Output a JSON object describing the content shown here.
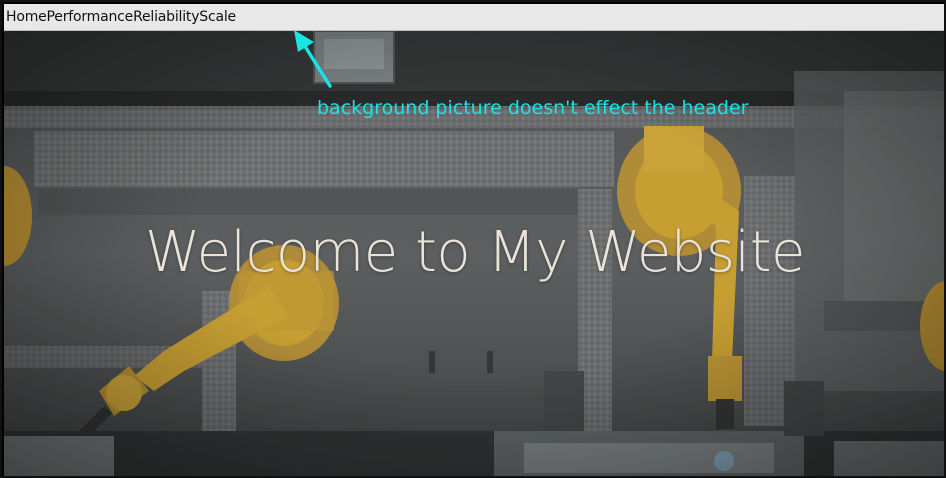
{
  "nav": {
    "items": [
      {
        "label": "Home"
      },
      {
        "label": "Performance"
      },
      {
        "label": "Reliability"
      },
      {
        "label": "Scale"
      }
    ]
  },
  "hero": {
    "title": "Welcome to My Website"
  },
  "annotation": {
    "text": "background picture doesn't effect the header",
    "color": "#19e3e3",
    "icon": "arrow-up-left-icon"
  },
  "colors": {
    "header_bg": "#e8e8e8",
    "title_color": "#e9e3da",
    "robot_arm": "#e2b43a"
  }
}
